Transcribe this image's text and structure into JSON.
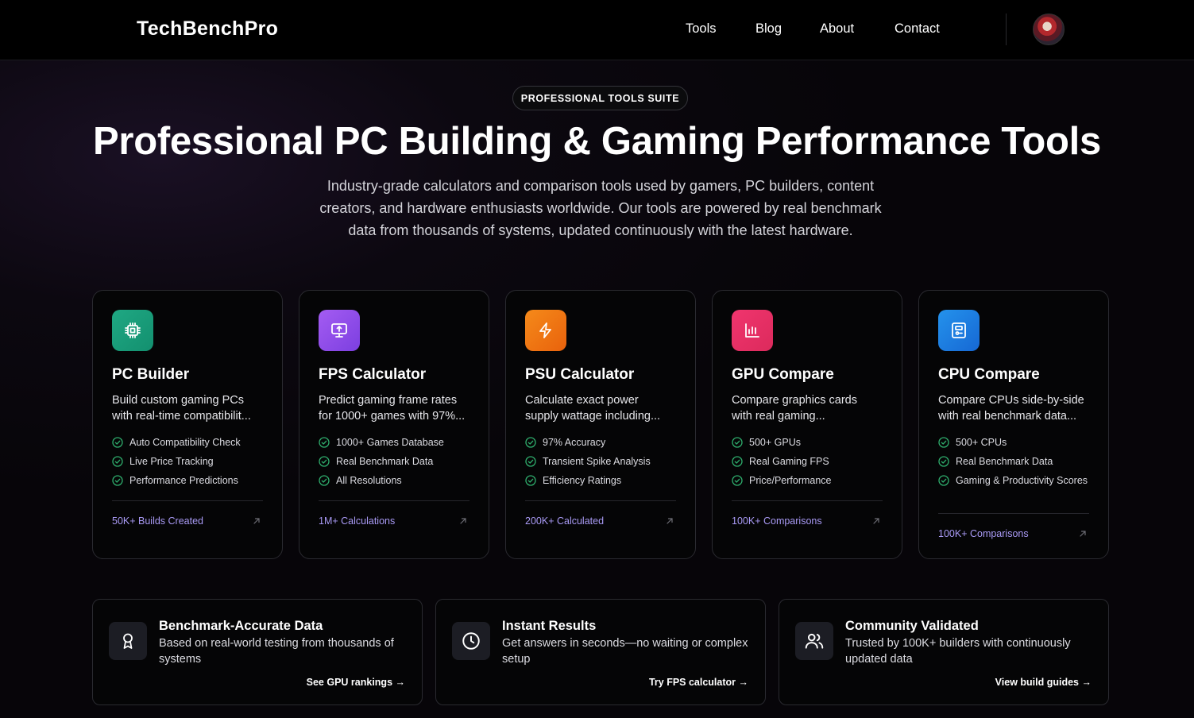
{
  "brand": {
    "name": "TechBenchPro"
  },
  "nav": {
    "items": [
      "Tools",
      "Blog",
      "About",
      "Contact"
    ]
  },
  "hero": {
    "badge": "PROFESSIONAL TOOLS SUITE",
    "title": "Professional PC Building & Gaming Performance Tools",
    "subtitle_lines": [
      "Industry-grade calculators and comparison tools used by gamers, PC builders, content",
      "creators, and hardware enthusiasts worldwide. Our tools are powered by real benchmark",
      "data from thousands of systems, updated continuously with the latest hardware."
    ]
  },
  "tools": [
    {
      "title": "PC Builder",
      "desc_lines": [
        "Build custom gaming PCs",
        "with real-time compatibilit..."
      ],
      "features": [
        "Auto Compatibility Check",
        "Live Price Tracking",
        "Performance Predictions"
      ],
      "stat": "50K+ Builds Created",
      "icon": "cpu-chip-icon",
      "color_from": "#1fa883",
      "color_to": "#13906f"
    },
    {
      "title": "FPS Calculator",
      "desc_lines": [
        "Predict gaming frame rates",
        "for 1000+ games with 97%..."
      ],
      "features": [
        "1000+ Games Database",
        "Real Benchmark Data",
        "All Resolutions"
      ],
      "stat": "1M+ Calculations",
      "icon": "monitor-icon",
      "color_from": "#a45cf2",
      "color_to": "#7c3fe0"
    },
    {
      "title": "PSU Calculator",
      "desc_lines": [
        "Calculate exact power",
        "supply wattage including..."
      ],
      "features": [
        "97% Accuracy",
        "Transient Spike Analysis",
        "Efficiency Ratings"
      ],
      "stat": "200K+ Calculated",
      "icon": "lightning-bolt-icon",
      "color_from": "#f58a1a",
      "color_to": "#e9620c"
    },
    {
      "title": "GPU Compare",
      "desc_lines": [
        "Compare graphics cards",
        "with real gaming..."
      ],
      "features": [
        "500+ GPUs",
        "Real Gaming FPS",
        "Price/Performance"
      ],
      "stat": "100K+ Comparisons",
      "icon": "bar-chart-icon",
      "color_from": "#f0356e",
      "color_to": "#dc2a5c"
    },
    {
      "title": "CPU Compare",
      "desc_lines": [
        "Compare CPUs side-by-side",
        "with real benchmark data..."
      ],
      "features": [
        "500+ CPUs",
        "Real Benchmark Data",
        "Gaming & Productivity Scores"
      ],
      "stat": "100K+ Comparisons",
      "icon": "processor-board-icon",
      "color_from": "#2492ec",
      "color_to": "#1668d4"
    }
  ],
  "highlights": [
    {
      "title": "Benchmark-Accurate Data",
      "desc": "Based on real-world testing from thousands of systems",
      "link": "See GPU rankings →",
      "icon": "award-ribbon-icon"
    },
    {
      "title": "Instant Results",
      "desc": "Get answers in seconds—no waiting or complex setup",
      "link": "Try FPS calculator →",
      "icon": "clock-icon"
    },
    {
      "title": "Community Validated",
      "desc": "Trusted by 100K+ builders with continuously updated data",
      "link": "View build guides →",
      "icon": "users-icon"
    }
  ],
  "colors": {
    "stat_accent": "#a99af5",
    "check_green": "#2fae6d"
  }
}
